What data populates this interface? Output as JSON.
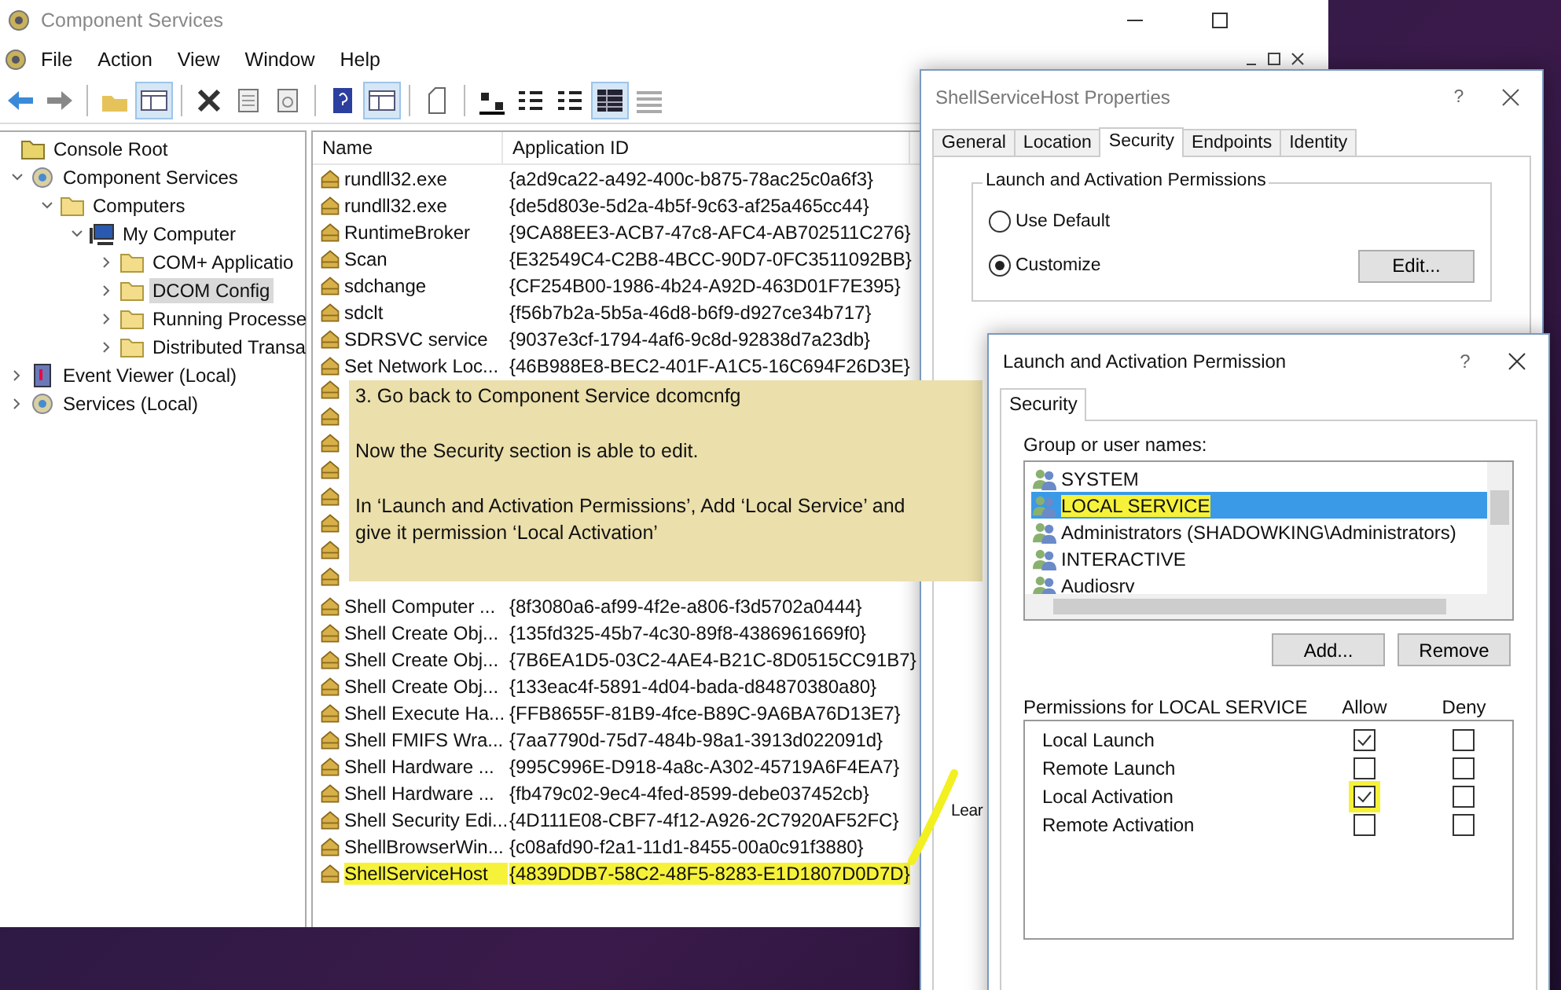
{
  "main_window": {
    "title": "Component Services",
    "menu": [
      "File",
      "Action",
      "View",
      "Window",
      "Help"
    ],
    "tree": {
      "root": "Console Root",
      "items": [
        {
          "label": "Component Services",
          "kind": "gear",
          "expanded": true,
          "selected": false,
          "children": [
            {
              "label": "Computers",
              "kind": "folder",
              "expanded": true,
              "selected": false,
              "children": [
                {
                  "label": "My Computer",
                  "kind": "computer",
                  "expanded": true,
                  "selected": false,
                  "children": [
                    {
                      "label": "COM+ Applicatio",
                      "kind": "folder",
                      "expanded": false,
                      "selected": false
                    },
                    {
                      "label": "DCOM Config",
                      "kind": "folder",
                      "expanded": false,
                      "selected": true
                    },
                    {
                      "label": "Running Processe",
                      "kind": "folder",
                      "expanded": false,
                      "selected": false
                    },
                    {
                      "label": "Distributed Transa",
                      "kind": "folder",
                      "expanded": false,
                      "selected": false
                    }
                  ]
                }
              ]
            }
          ]
        },
        {
          "label": "Event Viewer (Local)",
          "kind": "log",
          "expanded": false,
          "selected": false
        },
        {
          "label": "Services (Local)",
          "kind": "gear",
          "expanded": false,
          "selected": false
        }
      ]
    },
    "list": {
      "columns": [
        "Name",
        "Application ID"
      ],
      "rows_top": [
        {
          "name": "rundll32.exe",
          "app_id": "{a2d9ca22-a492-400c-b875-78ac25c0a6f3}",
          "highlighted": false
        },
        {
          "name": "rundll32.exe",
          "app_id": "{de5d803e-5d2a-4b5f-9c63-af25a465cc44}",
          "highlighted": false
        },
        {
          "name": "RuntimeBroker",
          "app_id": "{9CA88EE3-ACB7-47c8-AFC4-AB702511C276}",
          "highlighted": false
        },
        {
          "name": "Scan",
          "app_id": "{E32549C4-C2B8-4BCC-90D7-0FC3511092BB}",
          "highlighted": false
        },
        {
          "name": "sdchange",
          "app_id": "{CF254B00-1986-4b24-A92D-463D01F7E395}",
          "highlighted": false
        },
        {
          "name": "sdclt",
          "app_id": "{f56b7b2a-5b5a-46d8-b6f9-d927ce34b717}",
          "highlighted": false
        },
        {
          "name": "SDRSVC service",
          "app_id": "{9037e3cf-1794-4af6-9c8d-92838d7a23db}",
          "highlighted": false
        },
        {
          "name": "Set Network Loc...",
          "app_id": "{46B988E8-BEC2-401F-A1C5-16C694F26D3E}",
          "highlighted": false
        }
      ],
      "rows_bottom": [
        {
          "name": "Shell Computer ...",
          "app_id": "{8f3080a6-af99-4f2e-a806-f3d5702a0444}",
          "highlighted": false
        },
        {
          "name": "Shell Create Obj...",
          "app_id": "{135fd325-45b7-4c30-89f8-4386961669f0}",
          "highlighted": false
        },
        {
          "name": "Shell Create Obj...",
          "app_id": "{7B6EA1D5-03C2-4AE4-B21C-8D0515CC91B7}",
          "highlighted": false
        },
        {
          "name": "Shell Create Obj...",
          "app_id": "{133eac4f-5891-4d04-bada-d84870380a80}",
          "highlighted": false
        },
        {
          "name": "Shell Execute Ha...",
          "app_id": "{FFB8655F-81B9-4fce-B89C-9A6BA76D13E7}",
          "highlighted": false
        },
        {
          "name": "Shell FMIFS Wra...",
          "app_id": "{7aa7790d-75d7-484b-98a1-3913d022091d}",
          "highlighted": false
        },
        {
          "name": "Shell Hardware ...",
          "app_id": "{995C996E-D918-4a8c-A302-45719A6F4EA7}",
          "highlighted": false
        },
        {
          "name": "Shell Hardware ...",
          "app_id": "{fb479c02-9ec4-4fed-8599-debe037452cb}",
          "highlighted": false
        },
        {
          "name": "Shell Security Edi...",
          "app_id": "{4D111E08-CBF7-4f12-A926-2C7920AF52FC}",
          "highlighted": false
        },
        {
          "name": "ShellBrowserWin...",
          "app_id": "{c08afd90-f2a1-11d1-8455-00a0c91f3880}",
          "highlighted": false
        },
        {
          "name": "ShellServiceHost",
          "app_id": "{4839DDB7-58C2-48F5-8283-E1D1807D0D7D}",
          "highlighted": true
        }
      ]
    }
  },
  "note": {
    "lines": [
      "3. Go back to Component Service dcomcnfg",
      "Now the Security section is able to edit.",
      "In ‘Launch and Activation Permissions’, Add ‘Local Service’ and give it permission ‘Local Activation’"
    ]
  },
  "properties_dialog": {
    "title": "ShellServiceHost Properties",
    "help": "?",
    "tabs": [
      {
        "label": "General",
        "selected": false
      },
      {
        "label": "Location",
        "selected": false
      },
      {
        "label": "Security",
        "selected": true
      },
      {
        "label": "Endpoints",
        "selected": false
      },
      {
        "label": "Identity",
        "selected": false
      }
    ],
    "group_title": "Launch and Activation Permissions",
    "radios": [
      {
        "label": "Use Default",
        "selected": false
      },
      {
        "label": "Customize",
        "selected": true
      }
    ],
    "edit_button": "Edit...",
    "cut_text": "Lear"
  },
  "permission_dialog": {
    "title": "Launch and Activation Permission",
    "help": "?",
    "tabs": [
      {
        "label": "Security",
        "selected": true
      }
    ],
    "users_label": "Group or user names:",
    "users": [
      {
        "name": "SYSTEM",
        "selected": false,
        "highlighted": false
      },
      {
        "name": "LOCAL SERVICE",
        "selected": true,
        "highlighted": true
      },
      {
        "name": "Administrators (SHADOWKING\\Administrators)",
        "selected": false,
        "highlighted": false
      },
      {
        "name": "INTERACTIVE",
        "selected": false,
        "highlighted": false
      },
      {
        "name": "Audiosrv",
        "selected": false,
        "highlighted": false
      }
    ],
    "buttons": [
      "Add...",
      "Remove"
    ],
    "permissions_label": "Permissions for LOCAL SERVICE",
    "columns": [
      "Allow",
      "Deny"
    ],
    "permissions": [
      {
        "name": "Local Launch",
        "allow": true,
        "deny": false,
        "highlighted": false
      },
      {
        "name": "Remote Launch",
        "allow": false,
        "deny": false,
        "highlighted": false
      },
      {
        "name": "Local Activation",
        "allow": true,
        "deny": false,
        "highlighted": true
      },
      {
        "name": "Remote Activation",
        "allow": false,
        "deny": false,
        "highlighted": false
      }
    ]
  }
}
